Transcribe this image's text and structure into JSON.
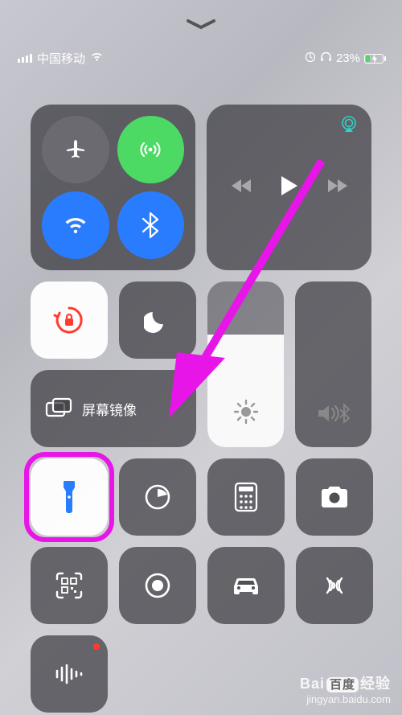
{
  "status": {
    "carrier": "中国移动",
    "battery_percent": "23%"
  },
  "connectivity": {
    "airplane": "airplane-icon",
    "cellular": "cellular-data-icon",
    "wifi": "wifi-icon",
    "bluetooth": "bluetooth-icon"
  },
  "media": {
    "prev": "rewind-icon",
    "play": "play-icon",
    "next": "forward-icon",
    "airplay": "airplay-icon"
  },
  "toggles": {
    "orientation_lock": "orientation-lock-icon",
    "dnd": "moon-icon"
  },
  "mirror": {
    "icon": "screen-mirroring-icon",
    "label": "屏幕镜像"
  },
  "sliders": {
    "brightness": "brightness-icon",
    "volume": "volume-bluetooth-icon"
  },
  "shortcuts": {
    "flashlight": "flashlight-icon",
    "timer": "timer-icon",
    "calculator": "calculator-icon",
    "camera": "camera-icon",
    "qr": "qr-scan-icon",
    "record": "screen-record-icon",
    "car": "car-icon",
    "nfc": "nfc-icon",
    "voice_memo": "voice-memo-icon"
  },
  "watermark": {
    "brand_left": "Bai",
    "brand_mid": "百度",
    "brand_right": "经验",
    "url": "jingyan.baidu.com"
  },
  "annotation": {
    "highlight_color": "#e815e8"
  }
}
